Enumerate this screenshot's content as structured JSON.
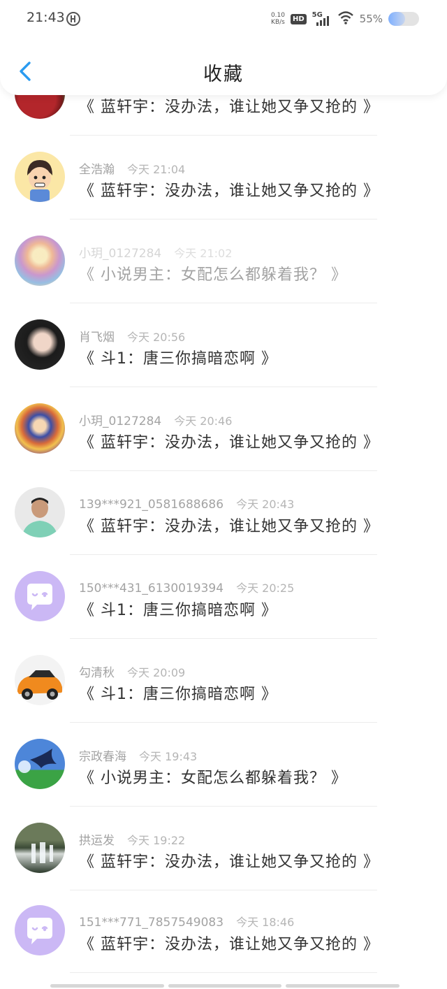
{
  "status_bar": {
    "time": "21:43",
    "net_speed_value": "0.10",
    "net_speed_unit": "KB/s",
    "hd_label": "HD",
    "signal_label": "5G",
    "battery": "55%"
  },
  "header": {
    "title": "收藏"
  },
  "items": [
    {
      "name": "",
      "time": "",
      "title": "《 蓝轩宇：没办法，谁让她又争又抢的 》"
    },
    {
      "name": "全浩瀚",
      "time": "今天 21:04",
      "title": "《 蓝轩宇：没办法，谁让她又争又抢的 》"
    },
    {
      "name": "小玥_0127284",
      "time": "今天 21:02",
      "title": "《 小说男主：女配怎么都躲着我？ 》"
    },
    {
      "name": "肖飞烟",
      "time": "今天 20:56",
      "title": "《 斗1：唐三你搞暗恋啊 》"
    },
    {
      "name": "小玥_0127284",
      "time": "今天 20:46",
      "title": "《 蓝轩宇：没办法，谁让她又争又抢的 》"
    },
    {
      "name": "139***921_0581688686",
      "time": "今天 20:43",
      "title": "《 蓝轩宇：没办法，谁让她又争又抢的 》"
    },
    {
      "name": "150***431_6130019394",
      "time": "今天 20:25",
      "title": "《 斗1：唐三你搞暗恋啊 》"
    },
    {
      "name": "勾清秋",
      "time": "今天 20:09",
      "title": "《 斗1：唐三你搞暗恋啊 》"
    },
    {
      "name": "宗政春海",
      "time": "今天 19:43",
      "title": "《 小说男主：女配怎么都躲着我？ 》"
    },
    {
      "name": "拱运发",
      "time": "今天 19:22",
      "title": "《 蓝轩宇：没办法，谁让她又争又抢的 》"
    },
    {
      "name": "151***771_7857549083",
      "time": "今天 18:46",
      "title": "《 蓝轩宇：没办法，谁让她又争又抢的 》"
    }
  ],
  "colors": {
    "accent": "#2a9bf0",
    "default_avatar": "#cbb8f5"
  }
}
